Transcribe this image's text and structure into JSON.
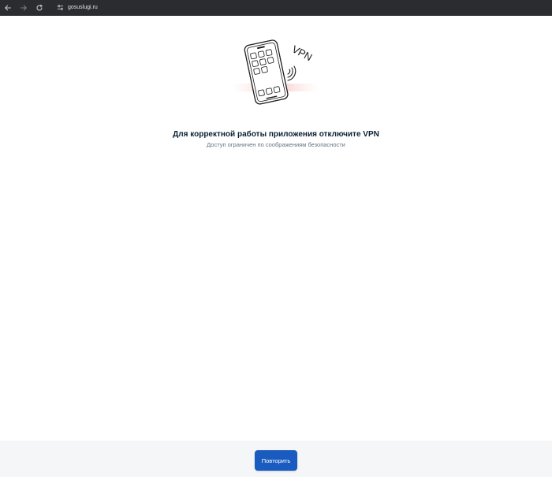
{
  "browser": {
    "url": "gosuslugi.ru",
    "back_icon": "arrow-left-icon",
    "forward_icon": "arrow-right-icon",
    "reload_icon": "reload-icon",
    "site_info_icon": "tune-icon"
  },
  "main": {
    "illustration_text": "VPN",
    "heading": "Для корректной работы приложения отключите VPN",
    "subheading": "Доступ ограничен по соображениям безопасности"
  },
  "footer": {
    "retry_label": "Повторить"
  },
  "colors": {
    "accent": "#1a5bbf",
    "heading": "#0b1f33",
    "subtext": "#66727f",
    "footer_bg": "#f4f6f8"
  }
}
